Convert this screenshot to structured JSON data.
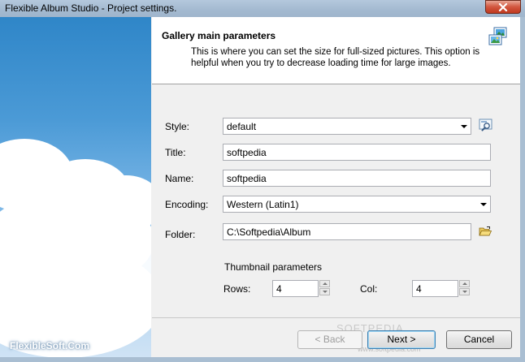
{
  "window": {
    "title": "Flexible Album Studio - Project settings."
  },
  "sidebar": {
    "brand": "FlexibleSoft.Com"
  },
  "header": {
    "title": "Gallery main parameters",
    "description": "This is where you can set the size for full-sized pictures.  This option is helpful when you try to decrease loading time for large images."
  },
  "form": {
    "style": {
      "label": "Style:",
      "value": "default"
    },
    "title": {
      "label": "Title:",
      "value": "softpedia"
    },
    "name": {
      "label": "Name:",
      "value": "softpedia"
    },
    "encoding": {
      "label": "Encoding:",
      "value": "Western (Latin1)"
    },
    "folder": {
      "label": "Folder:",
      "value": "C:\\Softpedia\\Album"
    },
    "thumbnail": {
      "heading": "Thumbnail parameters",
      "rows": {
        "label": "Rows:",
        "value": "4"
      },
      "col": {
        "label": "Col:",
        "value": "4"
      }
    }
  },
  "buttons": {
    "back": "< Back",
    "next": "Next >",
    "cancel": "Cancel"
  },
  "watermark": {
    "text": "SOFTPEDIA",
    "url": "www.softpedia.com"
  },
  "colors": {
    "titlebar": "#a3b9d0",
    "close": "#c0391f",
    "client": "#f0f0f0"
  }
}
